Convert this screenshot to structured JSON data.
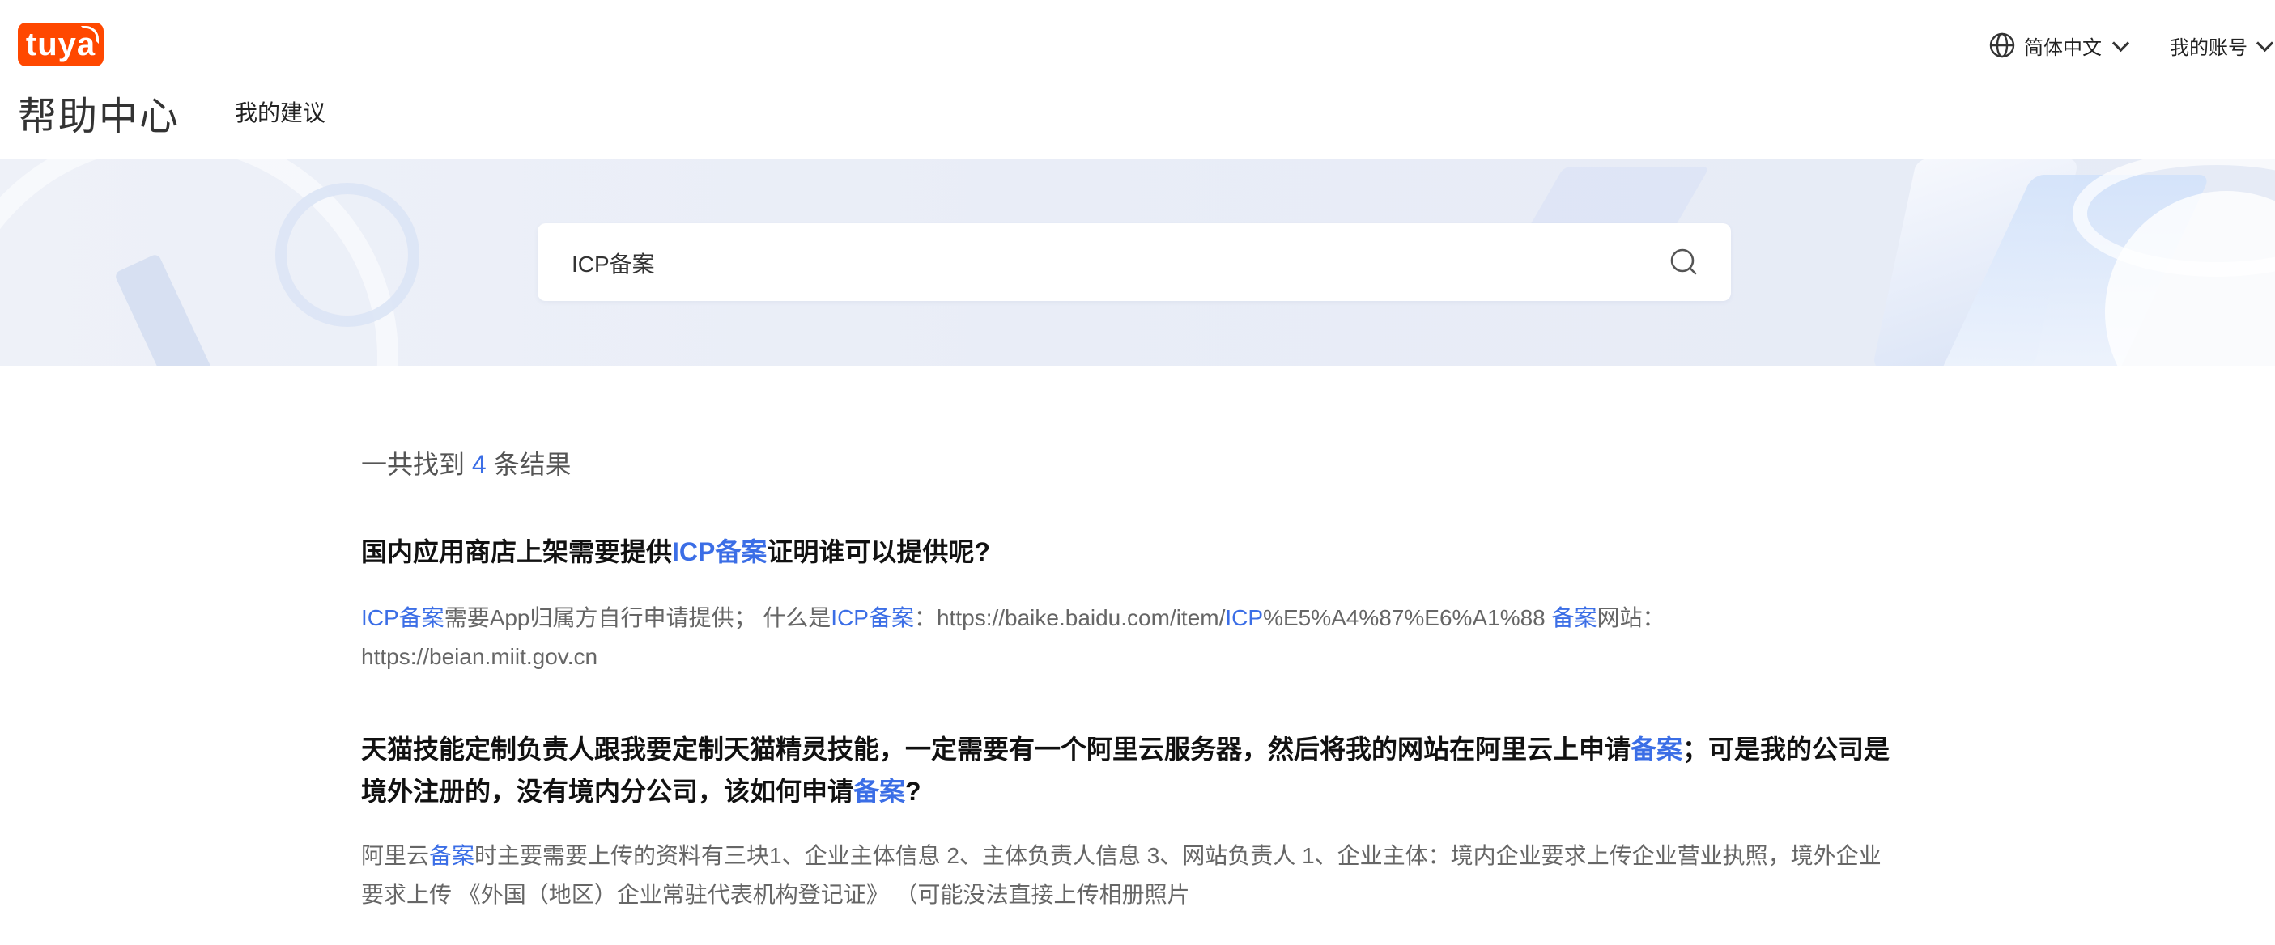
{
  "header": {
    "logo_text": "tuya",
    "title": "帮助中心",
    "nav_suggestions": "我的建议",
    "language": "简体中文",
    "account": "我的账号"
  },
  "search": {
    "value": "ICP备案"
  },
  "results": {
    "count_prefix": "一共找到 ",
    "count": "4",
    "count_suffix": " 条结果",
    "items": [
      {
        "title": [
          {
            "text": "国内应用商店上架需要提供",
            "hl": false
          },
          {
            "text": "ICP备案",
            "hl": true
          },
          {
            "text": "证明谁可以提供呢?",
            "hl": false
          }
        ],
        "excerpt": [
          {
            "text": "ICP备案",
            "hl": true
          },
          {
            "text": "需要App归属方自行申请提供； 什么是",
            "hl": false
          },
          {
            "text": "ICP备案",
            "hl": true
          },
          {
            "text": "：https://baike.baidu.com/item/",
            "hl": false
          },
          {
            "text": "ICP",
            "hl": true
          },
          {
            "text": "%E5%A4%87%E6%A1%88 ",
            "hl": false
          },
          {
            "text": "备案",
            "hl": true
          },
          {
            "text": "网站：https://beian.miit.gov.cn",
            "hl": false
          }
        ]
      },
      {
        "title": [
          {
            "text": "天猫技能定制负责人跟我要定制天猫精灵技能，一定需要有一个阿里云服务器，然后将我的网站在阿里云上申请",
            "hl": false
          },
          {
            "text": "备案",
            "hl": true
          },
          {
            "text": "；可是我的公司是境外注册的，没有境内分公司，该如何申请",
            "hl": false
          },
          {
            "text": "备案",
            "hl": true
          },
          {
            "text": "?",
            "hl": false
          }
        ],
        "excerpt": [
          {
            "text": "阿里云",
            "hl": false
          },
          {
            "text": "备案",
            "hl": true
          },
          {
            "text": "时主要需要上传的资料有三块1、企业主体信息 2、主体负责人信息 3、网站负责人 1、企业主体：境内企业要求上传企业营业执照，境外企业要求上传 《外国（地区）企业常驻代表机构登记证》 （可能没法直接上传相册照片",
            "hl": false
          }
        ]
      }
    ]
  },
  "colors": {
    "accent": "#3b6ee6",
    "brand": "#ff4800"
  }
}
